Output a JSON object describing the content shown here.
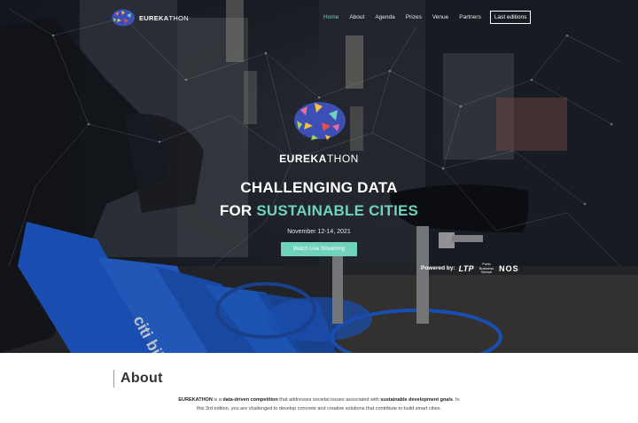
{
  "nav": {
    "logo_bold": "EUREKA",
    "logo_thin": "THON",
    "items": [
      {
        "label": "Home",
        "active": true
      },
      {
        "label": "About"
      },
      {
        "label": "Agenda"
      },
      {
        "label": "Prizes"
      },
      {
        "label": "Venue"
      },
      {
        "label": "Partners"
      }
    ],
    "last_editions": "Last editions"
  },
  "hero": {
    "brand_bold": "EUREKA",
    "brand_thin": "THON",
    "headline_line1": "CHALLENGING DATA",
    "headline_line2_prefix": "FOR ",
    "headline_line2_accent": "SUSTAINABLE CITIES",
    "date": "November 12-14, 2021",
    "watch_button": "Watch Live Streaming",
    "powered_by": "Powered by:",
    "sponsors": {
      "ltp": "LTP",
      "porto_line1": "Porto",
      "porto_line2": "Business",
      "porto_line3": "School",
      "nos": "NOS"
    },
    "bike_brand": "citi bike"
  },
  "about": {
    "title": "About",
    "p1_bold1": "EUREKATHON",
    "p1_text1": " is a ",
    "p1_bold2": "data-driven competition",
    "p1_text2": " that addresses societal issues associated with ",
    "p1_bold3": "sustainable development goals",
    "p1_text3": ". In this 3rd edition, you are challenged to develop concrete and creative solutions that contribute to build smart cities."
  },
  "colors": {
    "accent": "#6fd3b9",
    "hero_dark": "#1a1d26",
    "bike_blue": "#1f5fd6"
  }
}
